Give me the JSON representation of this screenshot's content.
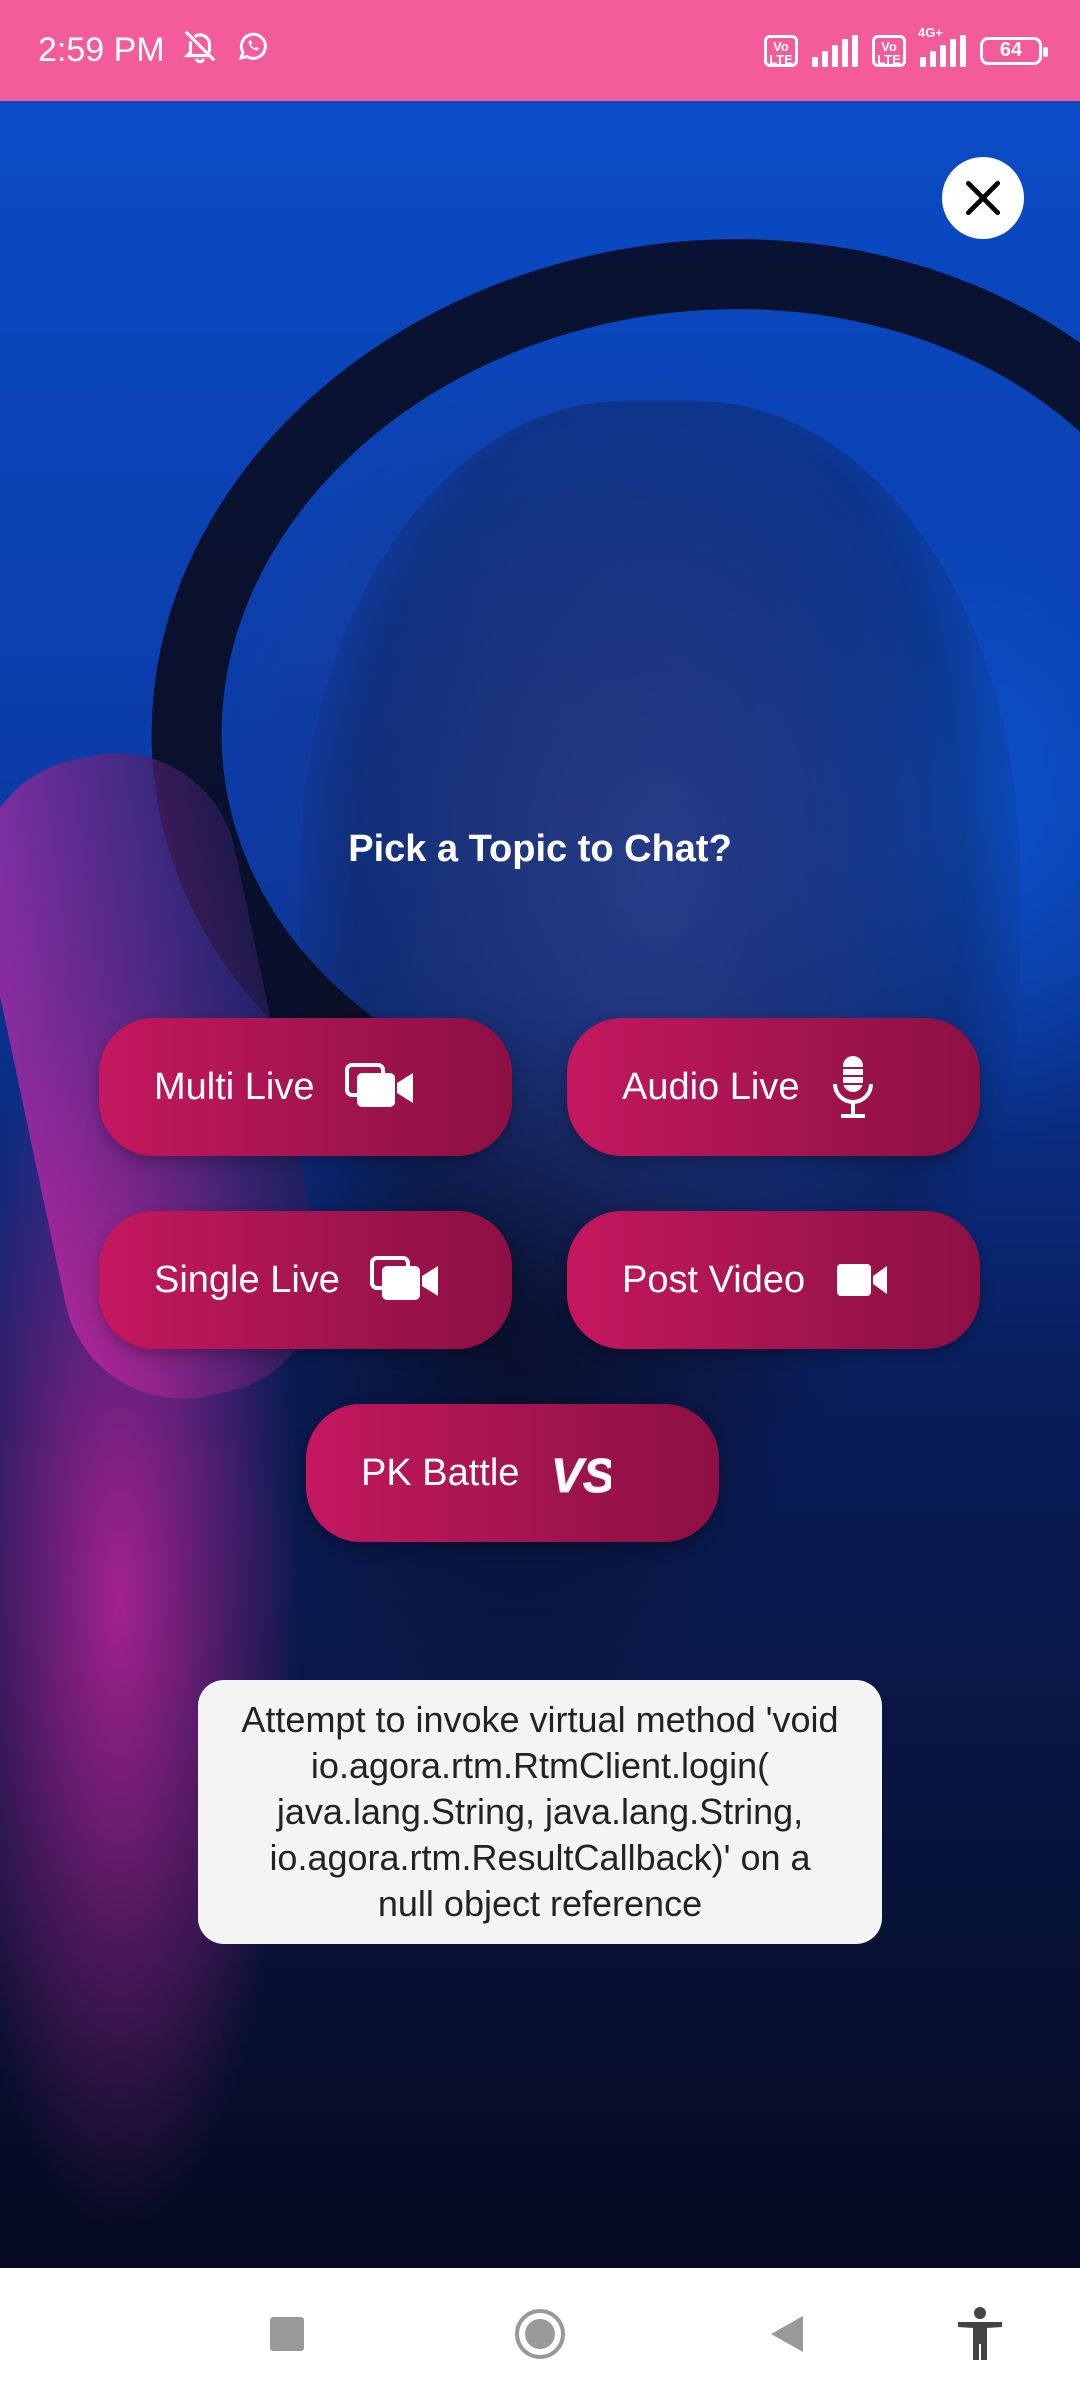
{
  "status_bar": {
    "time": "2:59 PM",
    "icons": [
      "bell-off-icon",
      "whatsapp-icon",
      "volte-icon",
      "signal-icon",
      "volte-icon",
      "signal-4g-icon"
    ],
    "volte_label": "Vo LTE",
    "network_label": "4G+",
    "battery_level": "64"
  },
  "main": {
    "prompt": "Pick a Topic to Chat?",
    "close_icon": "close-icon",
    "options": [
      {
        "label": "Multi Live",
        "icon": "multi-camera-icon"
      },
      {
        "label": "Audio Live",
        "icon": "microphone-icon"
      },
      {
        "label": "Single Live",
        "icon": "multi-camera-icon"
      },
      {
        "label": "Post Video",
        "icon": "video-camera-icon"
      },
      {
        "label": "PK Battle",
        "icon": "vs-icon"
      }
    ]
  },
  "toast": {
    "message": "Attempt to invoke virtual method 'void io.agora.rtm.RtmClient.login( java.lang.String, java.lang.String, io.agora.rtm.ResultCallback)' on a null object reference"
  },
  "nav_bar": {
    "items": [
      "recents-icon",
      "home-icon",
      "back-icon",
      "accessibility-icon"
    ]
  },
  "colors": {
    "status_bar": "#f45b9b",
    "pill": "#a0144d",
    "toast_bg": "#f4f4f4"
  }
}
